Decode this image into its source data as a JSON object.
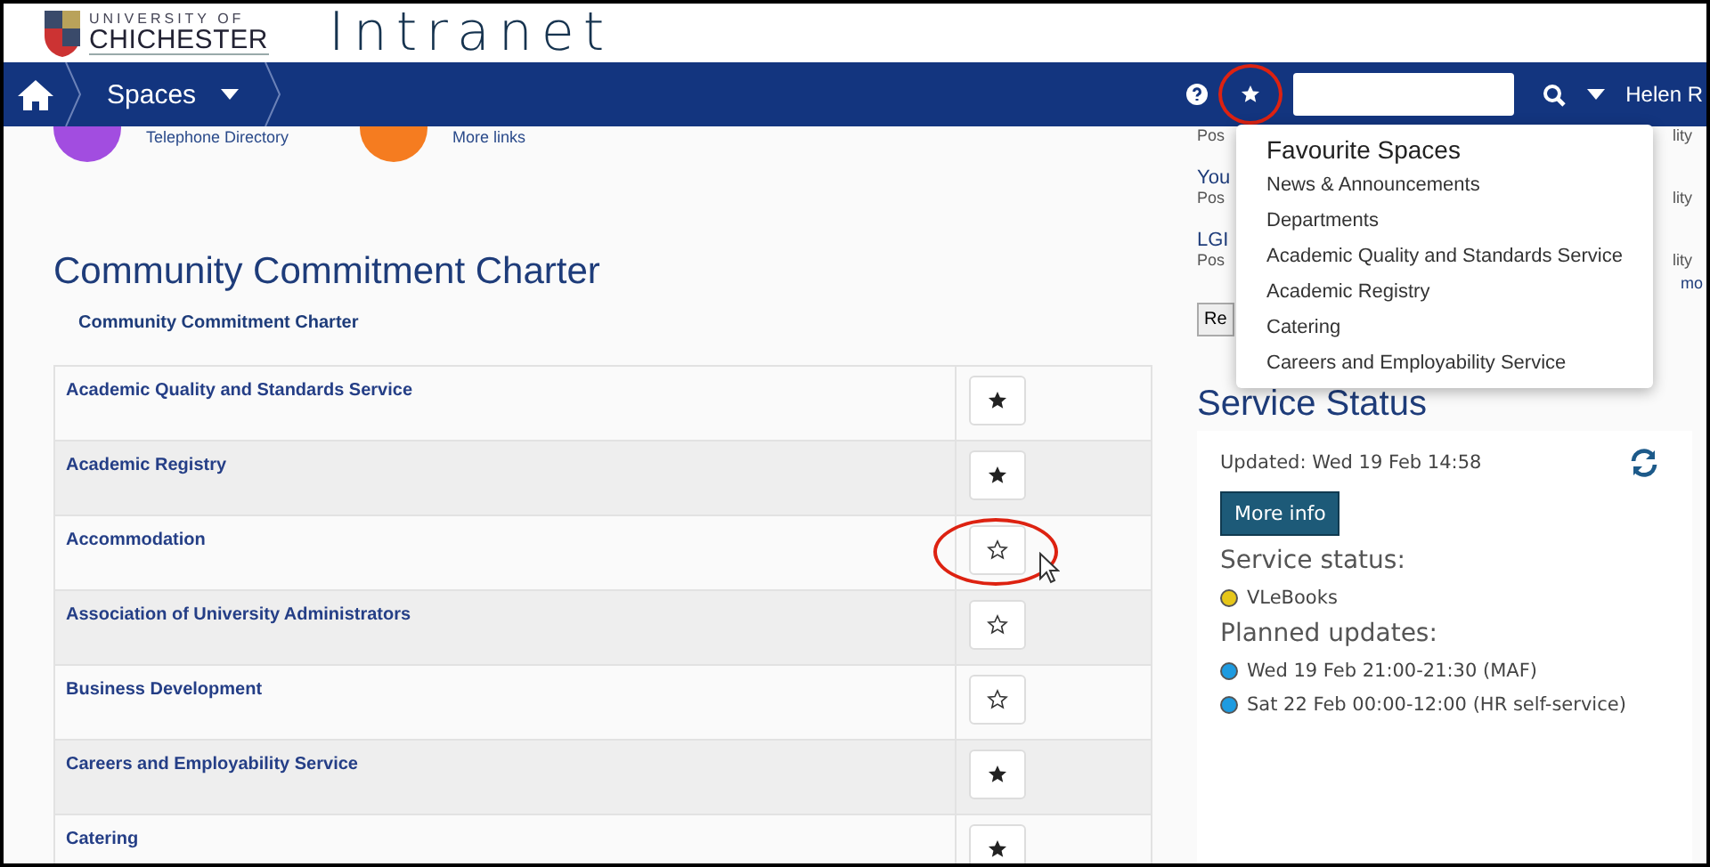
{
  "header": {
    "logo_line1": "UNIVERSITY OF",
    "logo_line2": "CHICHESTER",
    "title": "Intranet"
  },
  "nav": {
    "spaces": "Spaces",
    "favourites_circled": true,
    "user": "Helen R"
  },
  "favourites_menu": {
    "title": "Favourite Spaces",
    "items": [
      "News & Announcements",
      "Departments",
      "Academic Quality and Standards Service",
      "Academic Registry",
      "Catering",
      "Careers and Employability Service"
    ]
  },
  "quick_links": [
    {
      "label": "Telephone Directory",
      "color": "#a24de0"
    },
    {
      "label": "More links",
      "color": "#f57c20"
    }
  ],
  "page": {
    "title": "Community Commitment Charter",
    "breadcrumb": "Community Commitment Charter"
  },
  "spaces": [
    {
      "name": "Academic Quality and Standards Service",
      "favourite": true,
      "circled": false
    },
    {
      "name": "Academic Registry",
      "favourite": true,
      "circled": false
    },
    {
      "name": "Accommodation",
      "favourite": false,
      "circled": true
    },
    {
      "name": "Association of University Administrators",
      "favourite": false,
      "circled": false
    },
    {
      "name": "Business Development",
      "favourite": false,
      "circled": false
    },
    {
      "name": "Careers and Employability Service",
      "favourite": true,
      "circled": false
    },
    {
      "name": "Catering",
      "favourite": true,
      "circled": false
    }
  ],
  "news_fragments": [
    {
      "kind": "meta",
      "left": "Pos",
      "right": "lity"
    },
    {
      "kind": "title",
      "left": "You"
    },
    {
      "kind": "meta",
      "left": "Pos",
      "right": "lity"
    },
    {
      "kind": "title",
      "left": "LGI"
    },
    {
      "kind": "meta",
      "left": "Pos",
      "right": "lity"
    },
    {
      "kind": "link",
      "right": "mo"
    },
    {
      "kind": "button",
      "left": "Re"
    }
  ],
  "service_status": {
    "heading": "Service Status",
    "updated": "Updated: Wed 19 Feb 14:58",
    "button": "More info",
    "status_heading": "Service status:",
    "statuses": [
      {
        "label": "VLeBooks",
        "color": "#e6c619"
      }
    ],
    "planned_heading": "Planned updates:",
    "planned": [
      {
        "label": "Wed 19 Feb 21:00-21:30 (MAF)",
        "color": "#1e9be0"
      },
      {
        "label": "Sat 22 Feb 00:00-12:00 (HR self-service)",
        "color": "#1e9be0"
      }
    ]
  }
}
